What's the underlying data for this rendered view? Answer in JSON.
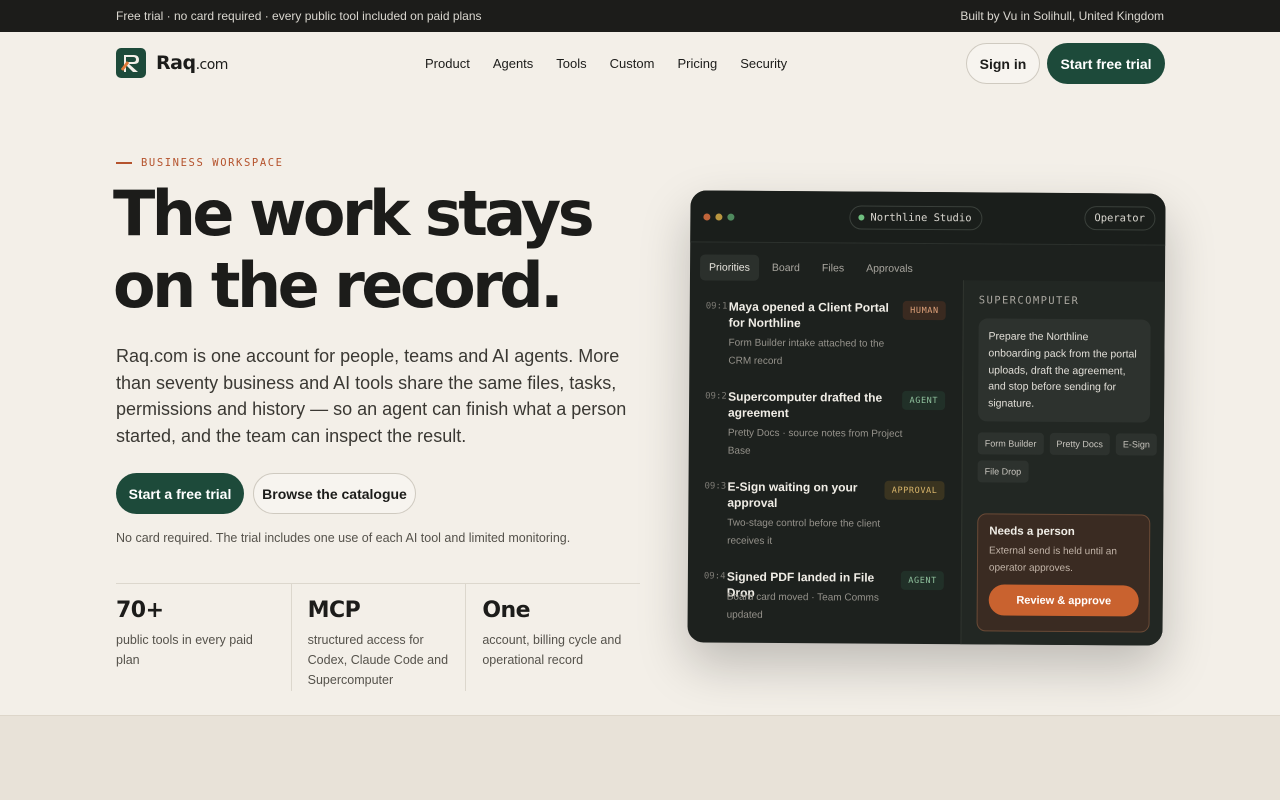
{
  "topbar": {
    "left": "Free trial · no card required · every public tool included on paid plans",
    "right": "Built by Vu in Solihull, United Kingdom"
  },
  "brand": {
    "name": "Raq",
    "suffix": ".com",
    "color": "#1d4a3a"
  },
  "nav": {
    "links": [
      "Product",
      "Agents",
      "Tools",
      "Custom",
      "Pricing",
      "Security"
    ],
    "sign_in": "Sign in",
    "start_trial": "Start free trial"
  },
  "hero": {
    "eyebrow": "BUSINESS WORKSPACE",
    "title_line1": "The work stays",
    "title_line2": "on the record.",
    "description": "Raq.com is one account for people, teams and AI agents. More than seventy business and AI tools share the same files, tasks, permissions and history — so an agent can finish what a person started, and the team can inspect the result.",
    "cta_primary": "Start a free trial",
    "cta_secondary": "Browse the catalogue",
    "note": "No card required. The trial includes one use of each AI tool and limited monitoring."
  },
  "stats": [
    {
      "value": "70+",
      "label": "public tools in every paid plan"
    },
    {
      "value": "MCP",
      "label": "structured access for Codex, Claude Code and Supercomputer"
    },
    {
      "value": "One",
      "label": "account, billing cycle and operational record"
    }
  ],
  "panel": {
    "workspace": "Northline Studio",
    "role": "Operator",
    "tabs": [
      "Priorities",
      "Board",
      "Files",
      "Approvals"
    ],
    "feed": [
      {
        "time": "09:14",
        "title": "Maya opened a Client Portal for Northline",
        "sub": "Form Builder intake attached to the CRM record",
        "tag": "HUMAN"
      },
      {
        "time": "09:21",
        "title": "Supercomputer drafted the agreement",
        "sub": "Pretty Docs · source notes from Project Base",
        "tag": "AGENT"
      },
      {
        "time": "09:33",
        "title": "E-Sign waiting on your approval",
        "sub": "Two-stage control before the client receives it",
        "tag": "APPROVAL"
      },
      {
        "time": "09:47",
        "title": "Signed PDF landed in File Drop",
        "sub": "Board card moved · Team Comms updated",
        "tag": "AGENT"
      }
    ],
    "side": {
      "heading": "SUPERCOMPUTER",
      "prompt": "Prepare the Northline onboarding pack from the portal uploads, draft the agreement, and stop before sending for signature.",
      "chips": [
        "Form Builder",
        "Pretty Docs",
        "E-Sign",
        "File Drop"
      ],
      "needs_title": "Needs a person",
      "needs_text": "External send is held until an operator approves.",
      "approve": "Review & approve"
    }
  }
}
